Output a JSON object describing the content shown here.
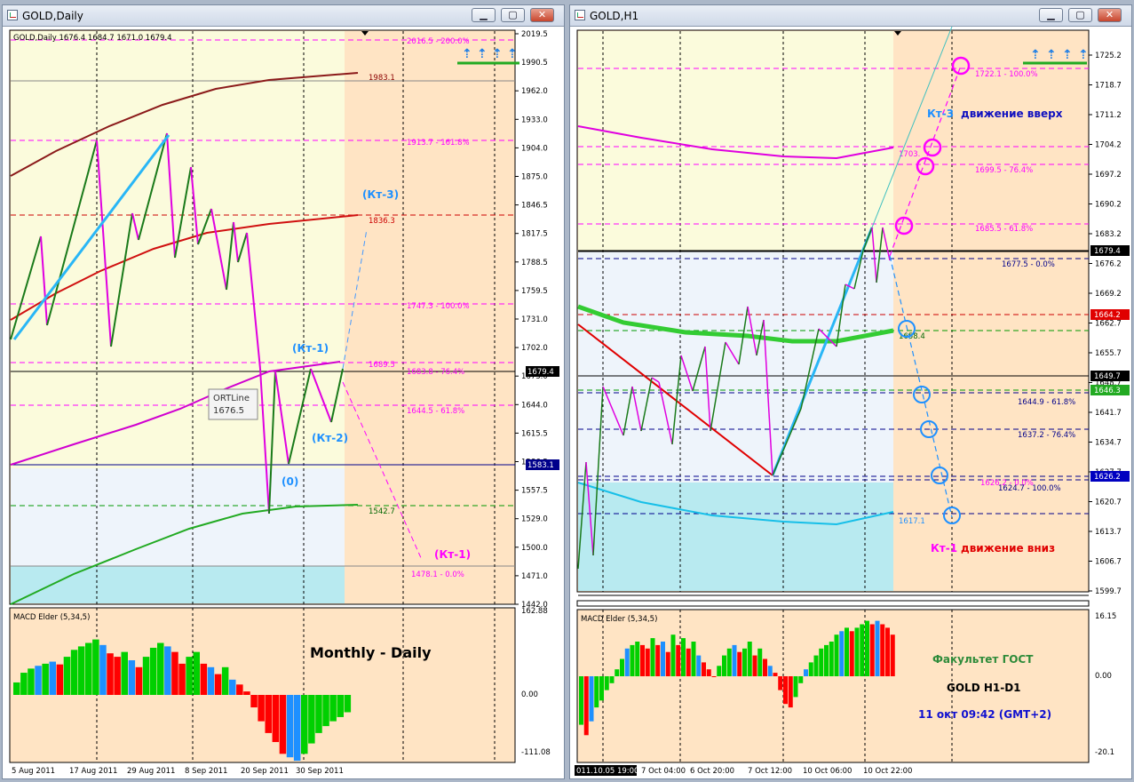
{
  "left_window": {
    "title": "GOLD,Daily",
    "header_info": "GOLD,Daily  1676.4 1684.7 1671.0 1679.4",
    "price_axis": [
      "2019.5",
      "1990.5",
      "1962.0",
      "1933.0",
      "1904.0",
      "1875.0",
      "1846.5",
      "1817.5",
      "1788.5",
      "1759.5",
      "1731.0",
      "1702.0",
      "1673.0",
      "1644.0",
      "1615.5",
      "1586.5",
      "1557.5",
      "1529.0",
      "1500.0",
      "1471.0",
      "1442.0"
    ],
    "time_axis": [
      "5 Aug 2011",
      "17 Aug 2011",
      "29 Aug 2011",
      "8 Sep 2011",
      "20 Sep 2011",
      "30 Sep 2011"
    ],
    "price_tags": [
      "1679.4",
      "1583.1"
    ],
    "fib_labels": [
      "2016.5 - 200.0%",
      "1913.7 - 161.8%",
      "1747.3 - 100.0%",
      "1689.5",
      "1683.8 - 76.4%",
      "1644.5 - 61.8%",
      "1478.1 - 0.0%"
    ],
    "ma_labels": [
      "1983.1",
      "1836.3",
      "1542.7"
    ],
    "wave_labels": {
      "kt3": "(Кт-3)",
      "kt1_top": "(Кт-1)",
      "kt2": "(Кт-2)",
      "zero": "(0)",
      "kt1_bottom": "(Кт-1)"
    },
    "tooltip": {
      "line1": "ORTLine",
      "line2": "1676.5"
    },
    "macd_label": "MACD Elder (5,34,5)",
    "macd_axis": [
      "162.88",
      "0.00",
      "-111.08"
    ],
    "caption": "Monthly - Daily",
    "macd_values": [
      18,
      32,
      38,
      42,
      45,
      48,
      44,
      55,
      65,
      70,
      75,
      80,
      72,
      60,
      55,
      62,
      50,
      40,
      55,
      68,
      75,
      70,
      62,
      45,
      55,
      62,
      45,
      40,
      30,
      40,
      22,
      15,
      5,
      -18,
      -38,
      -55,
      -68,
      -85,
      -90,
      -95,
      -85,
      -70,
      -55,
      -45,
      -38,
      -32,
      -25
    ]
  },
  "right_window": {
    "title": "GOLD,H1",
    "price_axis": [
      "1725.2",
      "1718.7",
      "1711.2",
      "1704.2",
      "1697.2",
      "1690.2",
      "1683.2",
      "1676.2",
      "1669.2",
      "1662.7",
      "1655.7",
      "1648.7",
      "1641.7",
      "1634.7",
      "1627.7",
      "1620.7",
      "1613.7",
      "1606.7",
      "1599.7"
    ],
    "time_axis": [
      "7 Oct 04:00",
      "6 Oct 20:00",
      "7 Oct 12:00",
      "10 Oct 06:00",
      "10 Oct 22:00"
    ],
    "time_cursor": "011.10.05 19:00",
    "price_tags": [
      "1679.4",
      "1664.2",
      "1649.7",
      "1646.3",
      "1626.2"
    ],
    "fib_labels": [
      "1722.1 - 100.0%",
      "1699.5 - 76.4%",
      "1685.5 - 61.8%",
      "1677.5 - 0.0%",
      "1644.9 - 61.8%",
      "1637.2 - 76.4%",
      "1626.2 - 0.0%",
      "1624.7 - 100.0%"
    ],
    "ma_labels": [
      "1703.",
      "1658.4",
      "1617.1"
    ],
    "annotations": {
      "up_prefix": "Кт-3",
      "up_text": "движение вверх",
      "down_prefix": "Кт-1",
      "down_text": "движение вниз"
    },
    "macd_label": "MACD Elder (5,34,5)",
    "macd_axis": [
      "16.15",
      "0.00",
      "-20.1"
    ],
    "footer": {
      "school": "Факультет ГОСТ",
      "pair": "GOLD  H1-D1",
      "date": "11 окт 09:42 (GMT+2)"
    },
    "macd_values": [
      -14,
      -17,
      -13,
      -9,
      -7,
      -4,
      -2,
      2,
      5,
      8,
      9,
      10,
      9,
      8,
      11,
      9,
      10,
      7,
      12,
      9,
      11,
      8,
      10,
      6,
      4,
      2,
      0,
      3,
      6,
      8,
      9,
      7,
      8,
      10,
      6,
      8,
      5,
      3,
      1,
      -4,
      -8,
      -9,
      -6,
      -2,
      2,
      4,
      6,
      8,
      9,
      10,
      12,
      13,
      14,
      13,
      14,
      15,
      16,
      15,
      16,
      15,
      14,
      12
    ]
  },
  "colors": {
    "chart_bg": "#ffe4c4",
    "zone_yellow": "#fbfbdc",
    "zone_blue": "#eef4fb",
    "zone_cyan": "#b8eaf0",
    "magenta": "#ff00ff",
    "green": "#00cc00",
    "blue": "#1f86ff",
    "red": "#ff0000",
    "darkgreen": "#006400"
  }
}
